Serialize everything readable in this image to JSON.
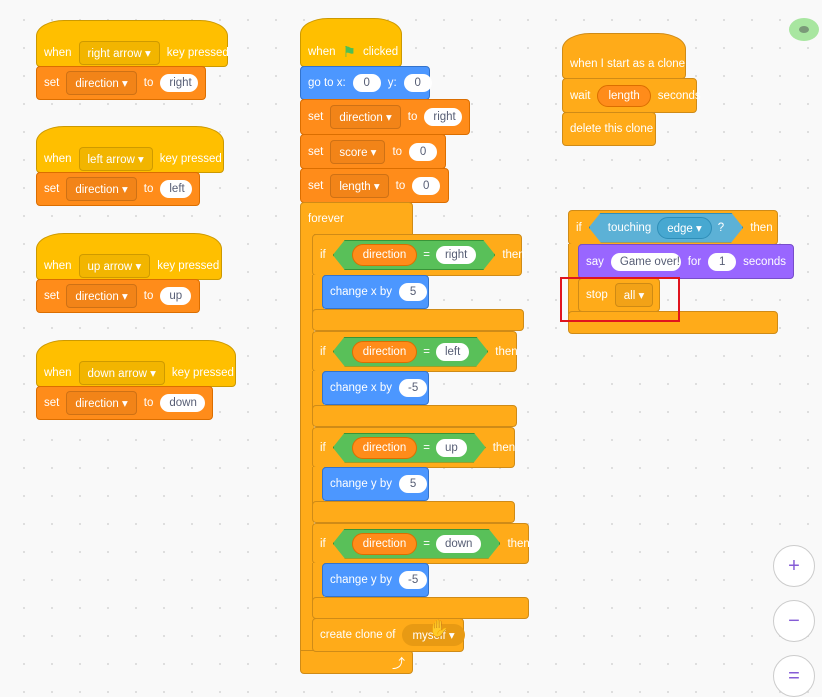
{
  "left_scripts": [
    {
      "when": "when",
      "key": "right arrow",
      "pressed": "key pressed",
      "set": "set",
      "var": "direction",
      "to": "to",
      "value": "right"
    },
    {
      "when": "when",
      "key": "left arrow",
      "pressed": "key pressed",
      "set": "set",
      "var": "direction",
      "to": "to",
      "value": "left"
    },
    {
      "when": "when",
      "key": "up arrow",
      "pressed": "key pressed",
      "set": "set",
      "var": "direction",
      "to": "to",
      "value": "up"
    },
    {
      "when": "when",
      "key": "down arrow",
      "pressed": "key pressed",
      "set": "set",
      "var": "direction",
      "to": "to",
      "value": "down"
    }
  ],
  "main": {
    "hat_when": "when",
    "hat_clicked": "clicked",
    "goto": {
      "label": "go to x:",
      "x": "0",
      "ylabel": "y:",
      "y": "0"
    },
    "sets": [
      {
        "set": "set",
        "var": "direction",
        "to": "to",
        "value": "right"
      },
      {
        "set": "set",
        "var": "score",
        "to": "to",
        "value": "0"
      },
      {
        "set": "set",
        "var": "length",
        "to": "to",
        "value": "0"
      }
    ],
    "forever": "forever",
    "ifs": [
      {
        "if": "if",
        "var": "direction",
        "eq": "=",
        "value": "right",
        "then": "then",
        "action": "change x by",
        "amount": "5"
      },
      {
        "if": "if",
        "var": "direction",
        "eq": "=",
        "value": "left",
        "then": "then",
        "action": "change x by",
        "amount": "-5"
      },
      {
        "if": "if",
        "var": "direction",
        "eq": "=",
        "value": "up",
        "then": "then",
        "action": "change y by",
        "amount": "5"
      },
      {
        "if": "if",
        "var": "direction",
        "eq": "=",
        "value": "down",
        "then": "then",
        "action": "change y by",
        "amount": "-5"
      }
    ],
    "clone": {
      "label": "create clone of",
      "target": "myself"
    }
  },
  "clone_script": {
    "hat": "when I start as a clone",
    "wait": "wait",
    "wait_var": "length",
    "seconds": "seconds",
    "delete": "delete this clone"
  },
  "edge_script": {
    "if": "if",
    "touching": "touching",
    "target": "edge",
    "q": "?",
    "then": "then",
    "say": "say",
    "message": "Game over!",
    "for": "for",
    "secs": "1",
    "seconds": "seconds",
    "stop": "stop",
    "stop_opt": "all"
  },
  "zoom": {
    "in": "+",
    "out": "−",
    "reset": "="
  },
  "colors": {
    "events": "#FFBF00",
    "motion": "#4C97FF",
    "variables": "#FF8C1A",
    "control": "#FFAB19",
    "operators": "#59C059",
    "sensing": "#5CB1D6",
    "looks": "#9966FF",
    "highlight": "#E0141E"
  }
}
